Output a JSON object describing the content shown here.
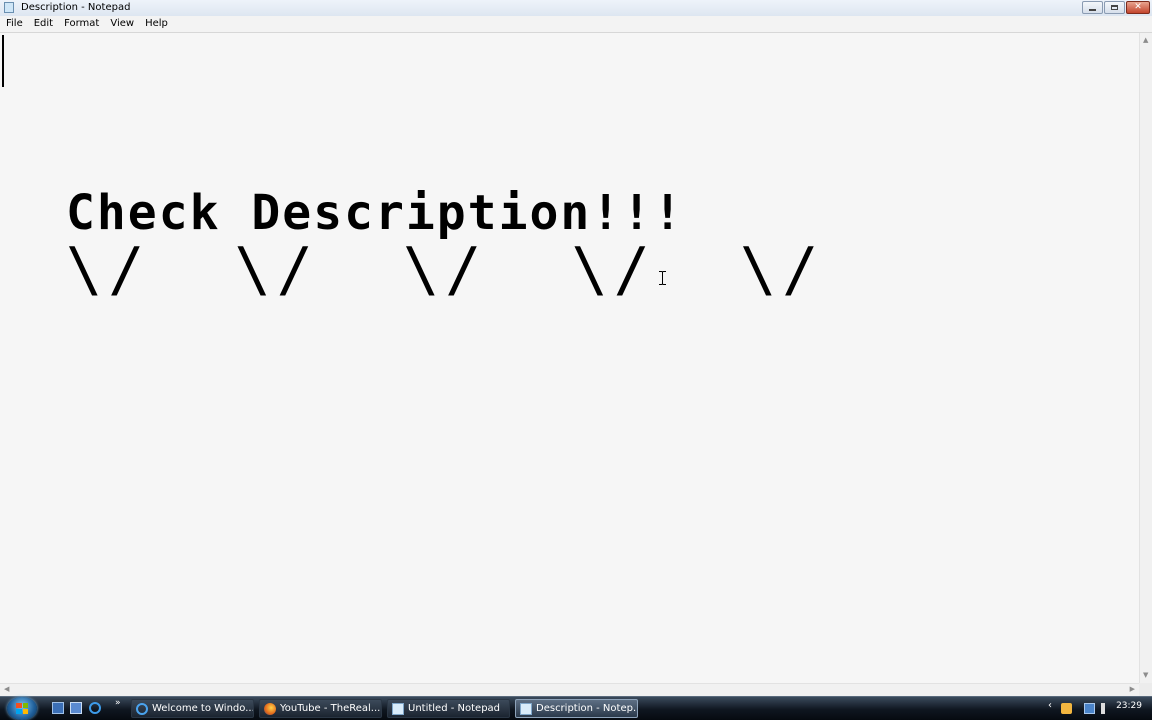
{
  "window": {
    "title": "Description - Notepad",
    "buttons": {
      "minimize": "minimize",
      "maximize": "maximize",
      "close": "✕"
    }
  },
  "menu": {
    "items": [
      "File",
      "Edit",
      "Format",
      "View",
      "Help"
    ]
  },
  "document": {
    "lines": [
      "Check Description!!!",
      "\\/  \\/  \\/  \\/  \\/"
    ]
  },
  "taskbar": {
    "quicklaunch_more": "»",
    "buttons": [
      {
        "label": "Welcome to Windo...",
        "icon": "ie-icon",
        "active": false
      },
      {
        "label": "YouTube - TheReal...",
        "icon": "firefox-icon",
        "active": false
      },
      {
        "label": "Untitled - Notepad",
        "icon": "notepad-icon",
        "active": false
      },
      {
        "label": "Description - Notep...",
        "icon": "notepad-icon",
        "active": true
      }
    ],
    "tray_chevron": "‹",
    "clock": "23:29"
  },
  "colors": {
    "editor_bg": "#f6f6f6",
    "taskbar": "#0f1620",
    "text": "#000000"
  }
}
